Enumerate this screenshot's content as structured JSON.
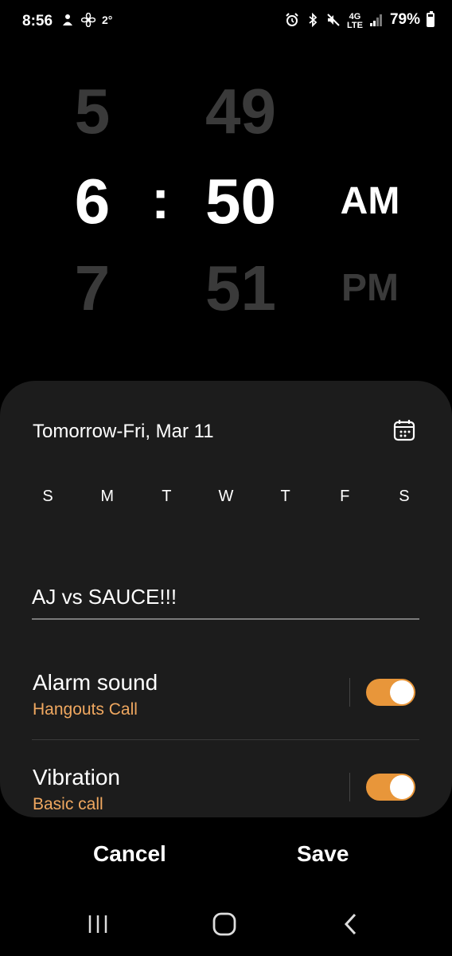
{
  "status_bar": {
    "time": "8:56",
    "temperature": "2°",
    "battery": "79%",
    "icons_left": [
      "person-alert-icon",
      "fan-icon"
    ],
    "icons_right": [
      "alarm-icon",
      "bluetooth-icon",
      "mute-icon",
      "lte-icon",
      "signal-icon",
      "battery-icon"
    ]
  },
  "picker": {
    "hour_prev": "5",
    "hour_selected": "6",
    "hour_next": "7",
    "separator": ":",
    "minute_prev": "49",
    "minute_selected": "50",
    "minute_next": "51",
    "ampm_selected": "AM",
    "ampm_next": "PM"
  },
  "sheet": {
    "date_label": "Tomorrow-Fri, Mar 11",
    "days": [
      "S",
      "M",
      "T",
      "W",
      "T",
      "F",
      "S"
    ],
    "alarm_name": "AJ vs SAUCE!!!",
    "alarm_sound": {
      "title": "Alarm sound",
      "value": "Hangouts Call",
      "enabled": true
    },
    "vibration": {
      "title": "Vibration",
      "value": "Basic call",
      "enabled": true
    }
  },
  "actions": {
    "cancel_label": "Cancel",
    "save_label": "Save"
  },
  "colors": {
    "accent": "#e8963a",
    "subtitle": "#f0a860",
    "sheet_bg": "#1c1c1c",
    "dim_text": "#3a3a3a"
  }
}
